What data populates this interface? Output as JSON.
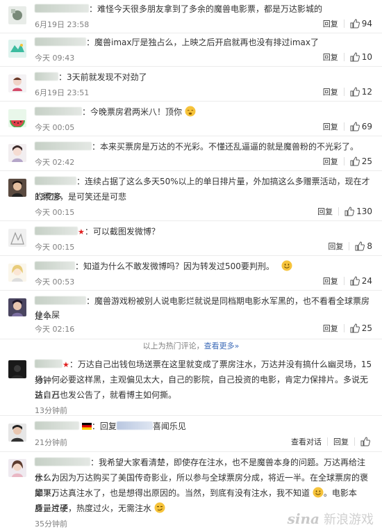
{
  "comments": [
    {
      "text": "：难怪今天很多朋友拿到了多余的魔兽电影票，都是万达影城的",
      "time": "6月19日 23:58",
      "reply": "回复",
      "likes": "94"
    },
    {
      "text": "：魔兽imax厅是独占么，上映之后开启就再也没有排过imax了",
      "time": "今天 09:43",
      "reply": "回复",
      "likes": "10"
    },
    {
      "text": "：3天前就发现不对劲了",
      "time": "6月19日 23:51",
      "reply": "回复",
      "likes": "12"
    },
    {
      "text": "：今晚票房君两米八！顶你",
      "time": "今天 00:05",
      "reply": "回复",
      "likes": "69"
    },
    {
      "text": "：本来买票房是万达的不光彩。不懂还乱逼逼的就是魔兽粉的不光彩了。",
      "time": "今天 02:42",
      "reply": "回复",
      "likes": "25"
    },
    {
      "text_1": "：连续占据了这么多天50%以上的单日排片量，外加搞这么多赠票活动，现在才13亿多",
      "text_2": "的票房，是可笑还是可悲",
      "time": "今天 00:15",
      "reply": "回复",
      "likes": "130"
    },
    {
      "text": "：可以截图发微博？",
      "time": "今天 00:15",
      "reply": "回复",
      "likes": "8"
    },
    {
      "text": "：知道为什么不敢发微博吗？因为转发过500要判刑。",
      "time": "今天 00:53",
      "reply": "回复",
      "likes": "24"
    },
    {
      "text_1": "：魔兽游戏粉被别人说电影烂就说是同档期电影水军黑的，也不看看全球票房是个",
      "text_2": "什么屎",
      "time": "今天 02:16",
      "reply": "回复",
      "likes": "25"
    }
  ],
  "divider": {
    "text": "以上为热门评论，",
    "link": "查看更多»"
  },
  "latest": [
    {
      "line_1": "：万达自己出钱包场送票在这里就变成了票房注水，万达并没有搞什么幽灵场，15分钟",
      "line_2": "场，何必要这样黑，主观偏见太大，自己的影院，自己投资的电影，肯定力保排片。多说无益，万",
      "line_3": "达自己也发公告了，就看博主如何撕。",
      "time": "13分钟前"
    },
    {
      "prefix": "：回复",
      "suffix": "喜闻乐见",
      "time": "21分钟前",
      "view_convo": "查看对话",
      "reply": "回复",
      "likes": ""
    },
    {
      "line_1": "：我希望大家看清楚，即使存在注水，也不是魔兽本身的问题。万达再给注水！为",
      "line_2": "什么，因为万达购买了美国传奇影业，所以参与全球票房分成，将近一半。在全球票房的褒靡下，",
      "line_3": "如果万达真注水了，也是想得出原因的。当然，到底有没有注水，我不知道",
      "line_3b": "。电影本身，片子",
      "line_4": "质量过硬，热度过火，无需注水",
      "time": "35分钟前"
    }
  ],
  "watermark": {
    "logo": "sina",
    "text": "新浪游戏"
  },
  "colors": {
    "link": "#3f6cb8",
    "meta": "#808080",
    "star": "#e02020"
  }
}
